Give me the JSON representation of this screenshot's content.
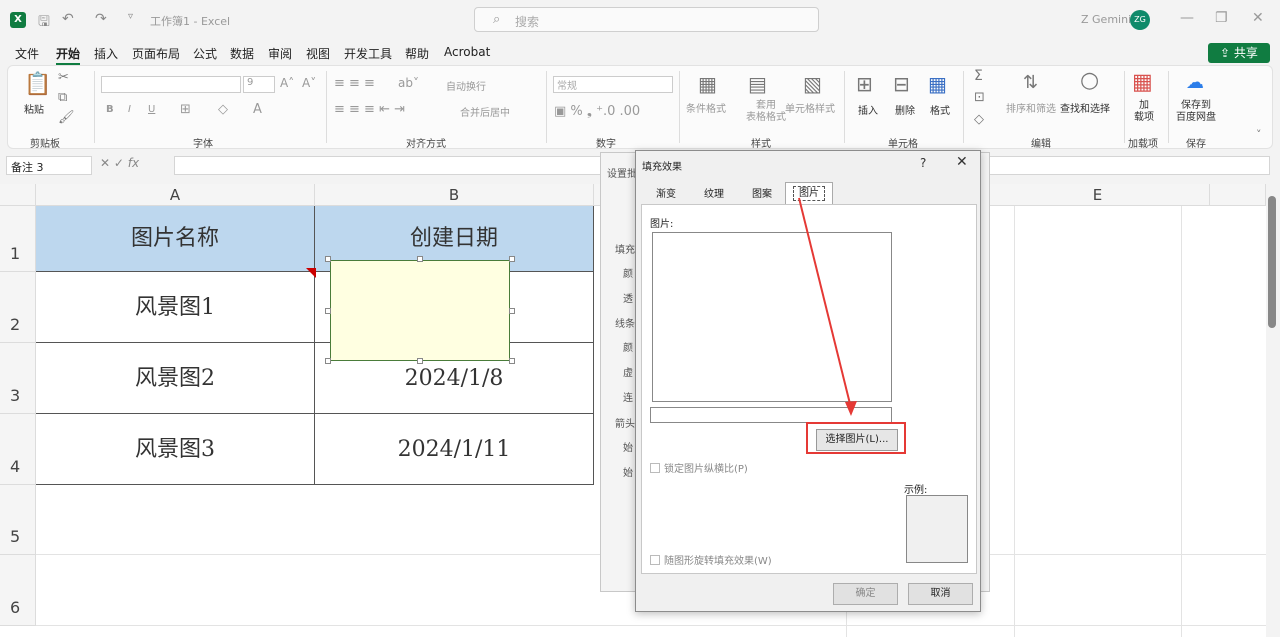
{
  "titlebar": {
    "title": "工作簿1 - Excel",
    "search_placeholder": "搜索",
    "user": "Z Gemini",
    "avatar": "ZG",
    "app_icon": "X"
  },
  "menu": {
    "items": [
      "文件",
      "开始",
      "插入",
      "页面布局",
      "公式",
      "数据",
      "审阅",
      "视图",
      "开发工具",
      "帮助",
      "Acrobat"
    ],
    "active": "开始",
    "share": "共享"
  },
  "ribbon": {
    "groups": [
      "剪贴板",
      "字体",
      "对齐方式",
      "数字",
      "样式",
      "单元格",
      "编辑",
      "加载项",
      "保存"
    ],
    "paste": "粘贴",
    "font_size": "9",
    "wrap": "自动换行",
    "merge": "合并后居中",
    "number_format": "常规",
    "cond_format": "条件格式",
    "table_format": "套用\n表格格式",
    "cell_style": "单元格样式",
    "insert": "插入",
    "delete": "删除",
    "format": "格式",
    "sort": "排序和筛选",
    "find": "查找和选择",
    "addin": "加\n载项",
    "save_baidu": "保存到\n百度网盘"
  },
  "formula": {
    "namebox": "备注 3",
    "fx": "fx"
  },
  "sheet": {
    "columns": [
      "A",
      "B",
      "",
      "",
      "E"
    ],
    "rows": [
      "1",
      "2",
      "3",
      "4",
      "5",
      "6"
    ],
    "cells": [
      [
        "图片名称",
        "创建日期"
      ],
      [
        "风景图1",
        ""
      ],
      [
        "风景图2",
        "2024/1/8"
      ],
      [
        "风景图3",
        "2024/1/11"
      ]
    ]
  },
  "back_dialog": {
    "title": "设置批",
    "labels": [
      "填充",
      "颜",
      "透",
      "线条",
      "颜",
      "虚",
      "连",
      "箭头",
      "始",
      "始"
    ]
  },
  "dialog": {
    "title": "填充效果",
    "help": "?",
    "close": "✕",
    "tabs": [
      "渐变",
      "纹理",
      "图案",
      "图片"
    ],
    "active_tab": "图片",
    "picture_label": "图片:",
    "select_button": "选择图片(L)...",
    "lock_aspect": "锁定图片纵横比(P)",
    "rotate": "随图形旋转填充效果(W)",
    "sample": "示例:",
    "ok": "确定",
    "cancel": "取消"
  },
  "colors": {
    "accent": "#107c41",
    "header_fill": "#bdd7ee",
    "note_fill": "#ffffe1",
    "annotation": "#e53935"
  }
}
